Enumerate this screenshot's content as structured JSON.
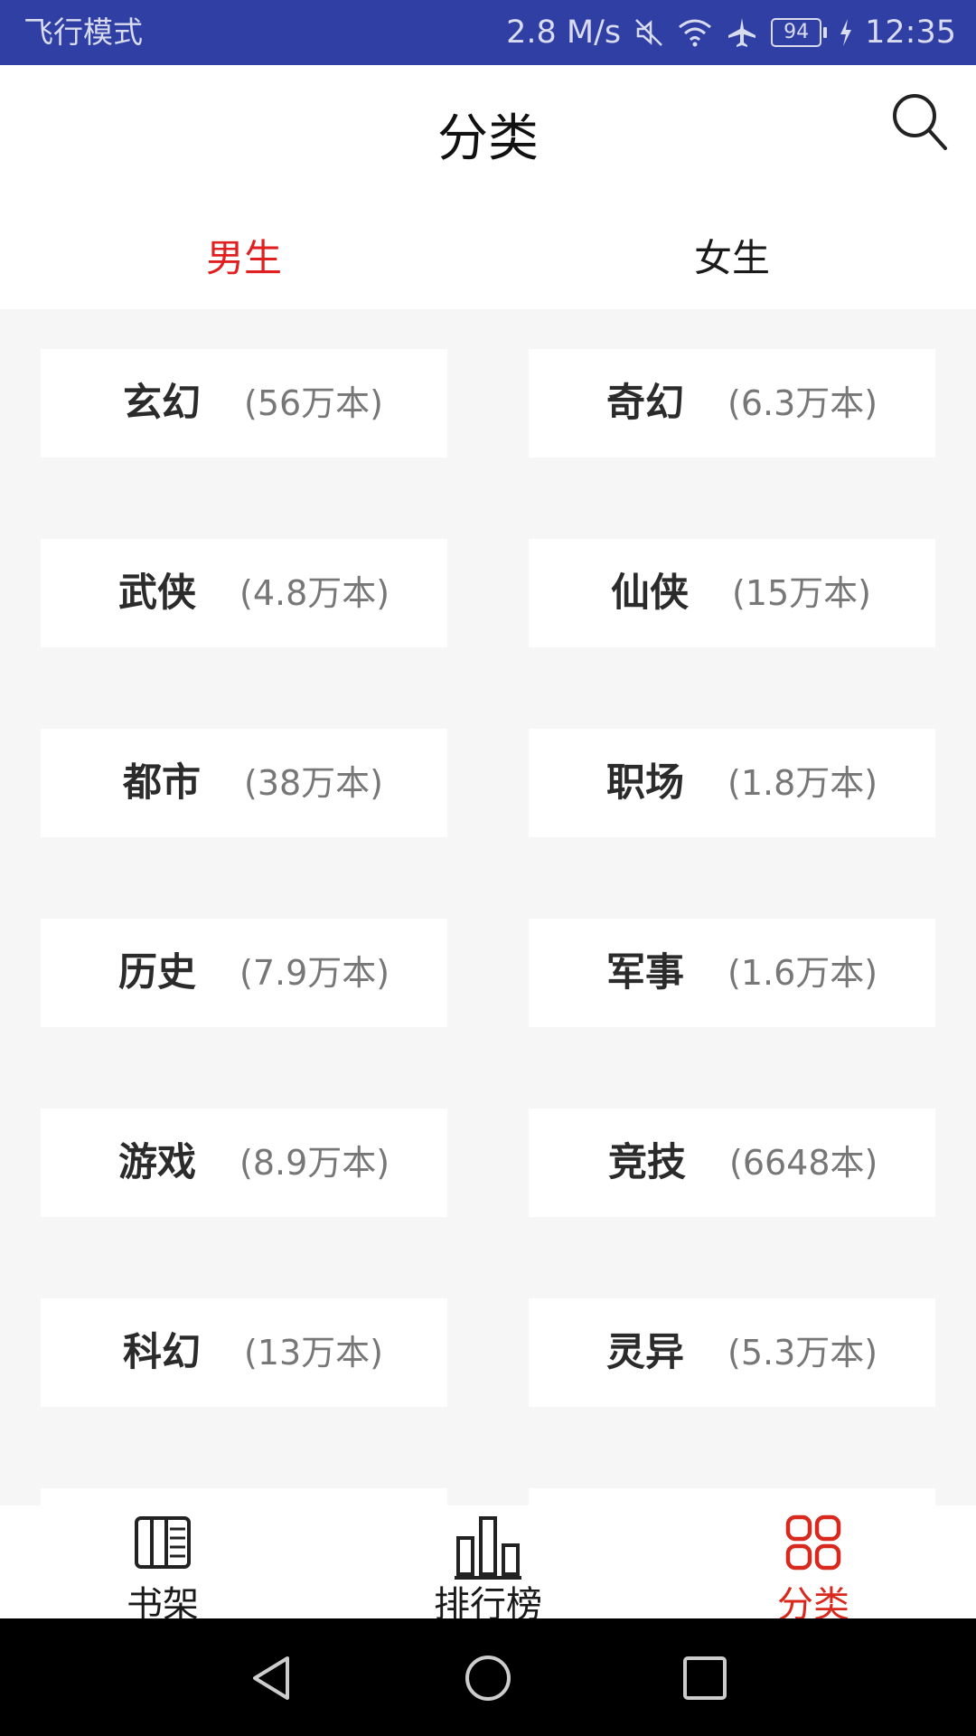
{
  "status_bar": {
    "mode_text": "飞行模式",
    "speed": "2.8 M/s",
    "battery": "94",
    "time": "12:35",
    "icons": [
      "mute-icon",
      "wifi-icon",
      "airplane-icon",
      "battery-icon",
      "charging-icon"
    ]
  },
  "header": {
    "title": "分类",
    "search_icon": "search-icon"
  },
  "tabs": [
    {
      "label": "男生",
      "active": true
    },
    {
      "label": "女生",
      "active": false
    }
  ],
  "categories": [
    {
      "name": "玄幻",
      "count": "(56万本)"
    },
    {
      "name": "奇幻",
      "count": "(6.3万本)"
    },
    {
      "name": "武侠",
      "count": "(4.8万本)"
    },
    {
      "name": "仙侠",
      "count": "(15万本)"
    },
    {
      "name": "都市",
      "count": "(38万本)"
    },
    {
      "name": "职场",
      "count": "(1.8万本)"
    },
    {
      "name": "历史",
      "count": "(7.9万本)"
    },
    {
      "name": "军事",
      "count": "(1.6万本)"
    },
    {
      "name": "游戏",
      "count": "(8.9万本)"
    },
    {
      "name": "竞技",
      "count": "(6648本)"
    },
    {
      "name": "科幻",
      "count": "(13万本)"
    },
    {
      "name": "灵异",
      "count": "(5.3万本)"
    }
  ],
  "bottom_nav": [
    {
      "label": "书架",
      "icon": "bookshelf-icon",
      "active": false
    },
    {
      "label": "排行榜",
      "icon": "ranking-icon",
      "active": false
    },
    {
      "label": "分类",
      "icon": "category-icon",
      "active": true
    }
  ],
  "colors": {
    "status_bar_bg": "#2f3fa3",
    "accent": "#e02020",
    "text_dark": "#2b2b2b",
    "text_gray": "#777777",
    "page_bg": "#f6f6f6"
  }
}
